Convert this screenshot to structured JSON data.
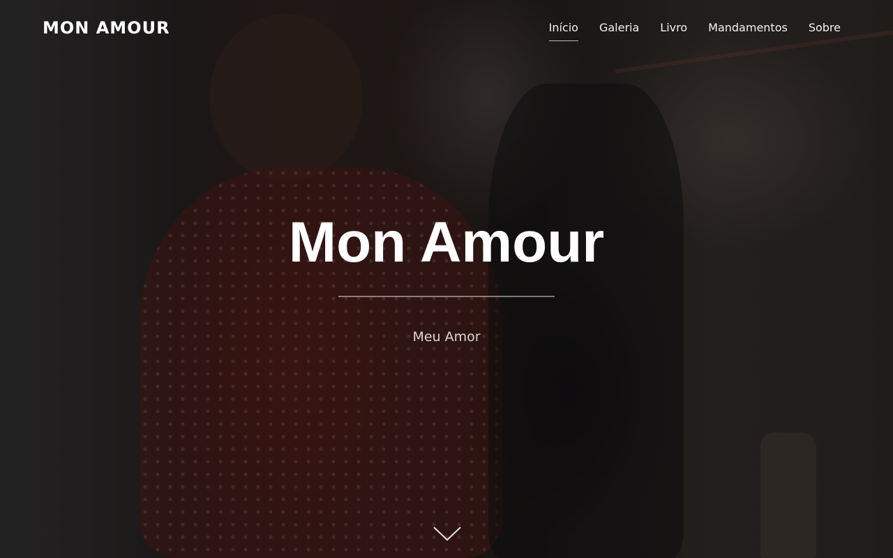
{
  "header": {
    "logo": "MON AMOUR",
    "nav": [
      {
        "label": "Início",
        "active": true
      },
      {
        "label": "Galeria",
        "active": false
      },
      {
        "label": "Livro",
        "active": false
      },
      {
        "label": "Mandamentos",
        "active": false
      },
      {
        "label": "Sobre",
        "active": false
      }
    ]
  },
  "hero": {
    "title": "Mon Amour",
    "subtitle": "Meu Amor",
    "scroll_icon": "chevron-down-icon"
  },
  "colors": {
    "text": "#ffffff",
    "subtitle": "#d8d8d8",
    "overlay": "#000000"
  }
}
